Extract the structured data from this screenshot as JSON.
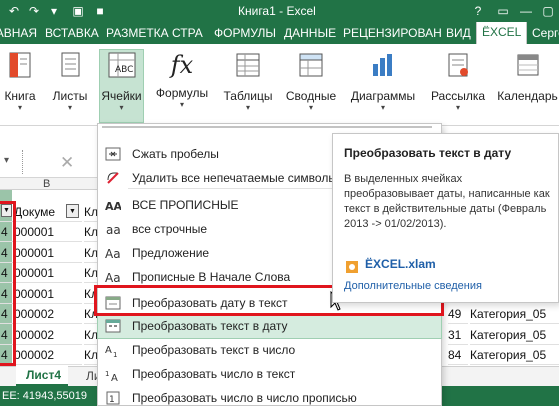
{
  "window": {
    "title": "Книга1 - Excel"
  },
  "tabs": [
    {
      "label": "ГЛАВНАЯ"
    },
    {
      "label": "ВСТАВКА"
    },
    {
      "label": "РАЗМЕТКА СТРА"
    },
    {
      "label": "ФОРМУЛЫ"
    },
    {
      "label": "ДАННЫЕ"
    },
    {
      "label": "РЕЦЕНЗИРОВАН"
    },
    {
      "label": "ВИД"
    },
    {
      "label": "ЁXCEL"
    },
    {
      "label": "Серге"
    }
  ],
  "ribbon": {
    "buttons": [
      {
        "label": "Книга",
        "icon": "book-icon"
      },
      {
        "label": "Листы",
        "icon": "sheets-icon"
      },
      {
        "label": "Ячейки",
        "icon": "cells-icon"
      },
      {
        "label": "Формулы",
        "icon": "fx-icon"
      },
      {
        "label": "Таблицы",
        "icon": "table-icon"
      },
      {
        "label": "Сводные",
        "icon": "pivot-icon"
      },
      {
        "label": "Диаграммы",
        "icon": "chart-icon"
      },
      {
        "label": "Рассылка",
        "icon": "mail-icon"
      },
      {
        "label": "Календарь",
        "icon": "calendar-icon"
      }
    ]
  },
  "formula_bar": {
    "cancel_symbol": "✕"
  },
  "grid": {
    "col_b_header": "B",
    "header_row": {
      "col_b": "Докуме",
      "col_c": "Кл"
    },
    "rows": [
      {
        "col_a": "4",
        "col_b": "000001",
        "col_c": "Кл"
      },
      {
        "col_a": "4",
        "col_b": "000001",
        "col_c": "Кл"
      },
      {
        "col_a": "4",
        "col_b": "000001",
        "col_c": "Кл"
      },
      {
        "col_a": "4",
        "col_b": "000001",
        "col_c": "Кл"
      },
      {
        "col_a": "4",
        "col_b": "000002",
        "col_c": "Кл",
        "right_num": "49",
        "right_cat": "Категория_05"
      },
      {
        "col_a": "4",
        "col_b": "000002",
        "col_c": "Кл",
        "right_num": "31",
        "right_cat": "Категория_05"
      },
      {
        "col_a": "4",
        "col_b": "000002",
        "col_c": "Кл",
        "right_num": "84",
        "right_cat": "Категория_05"
      }
    ]
  },
  "sheet_tabs": {
    "active": "Лист4",
    "partial": "Ли"
  },
  "status_bar": {
    "text": "ЕЕ: 41943,55019"
  },
  "menu": {
    "items": [
      {
        "label": "Сжать пробелы",
        "icon": "compress-spaces-icon"
      },
      {
        "label": "Удалить все непечатаемые символы",
        "icon": "delete-nonprintable-icon"
      },
      {
        "label": "ВСЕ ПРОПИСНЫЕ",
        "icon": "uppercase-icon"
      },
      {
        "label": "все строчные",
        "icon": "lowercase-icon"
      },
      {
        "label": "Предложение",
        "icon": "sentence-case-icon"
      },
      {
        "label": "Прописные В Начале Слова",
        "icon": "title-case-icon"
      },
      {
        "label": "Преобразовать дату в текст",
        "icon": "date-to-text-icon"
      },
      {
        "label": "Преобразовать текст в дату",
        "icon": "text-to-date-icon"
      },
      {
        "label": "Преобразовать текст в число",
        "icon": "text-to-number-icon"
      },
      {
        "label": "Преобразовать число в текст",
        "icon": "number-to-text-icon"
      },
      {
        "label": "Преобразовать число в число прописью",
        "icon": "number-to-words-icon"
      }
    ]
  },
  "tooltip": {
    "title": "Преобразовать текст в дату",
    "body": "В выделенных ячейках преобразовывает даты, написанные как текст в действительные даты (Февраль 2013 -> 01/02/2013).",
    "file": "ЁXCEL.xlam",
    "more": "Дополнительные сведения"
  },
  "colors": {
    "excel_green": "#217346",
    "highlight": "#d5ecdf",
    "red_outline": "#e0151d",
    "link": "#1f5fa8"
  }
}
